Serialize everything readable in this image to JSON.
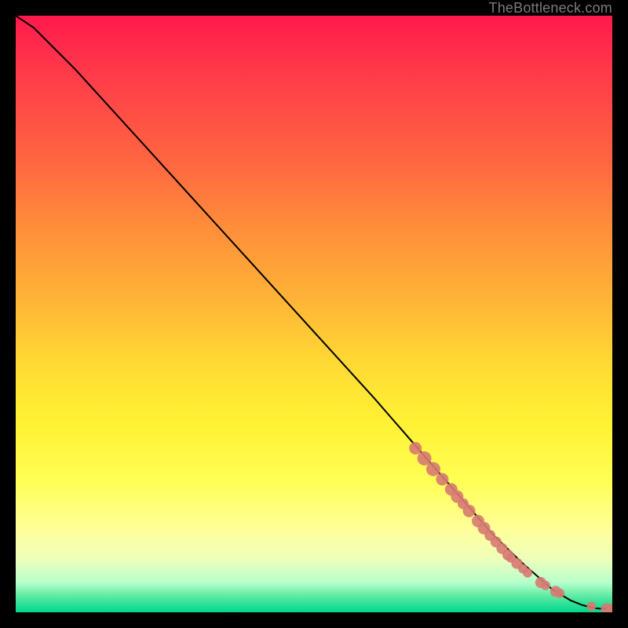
{
  "attribution": "TheBottleneck.com",
  "chart_data": {
    "type": "line",
    "title": "",
    "xlabel": "",
    "ylabel": "",
    "xlim": [
      0,
      100
    ],
    "ylim": [
      0,
      100
    ],
    "grid": false,
    "series": [
      {
        "name": "curve",
        "style": "line",
        "color": "#000000",
        "x": [
          0,
          3,
          6,
          10,
          20,
          30,
          40,
          50,
          60,
          70,
          80,
          85,
          90,
          93,
          95,
          97,
          98,
          100
        ],
        "y": [
          100,
          98,
          95,
          91,
          80,
          69,
          58,
          47,
          36,
          24.5,
          13,
          8.2,
          3.8,
          2.0,
          1.2,
          0.7,
          0.6,
          0.6
        ]
      },
      {
        "name": "points",
        "style": "scatter",
        "color": "#d77a72",
        "x": [
          67,
          68.5,
          70,
          71.5,
          73,
          74,
          75,
          76,
          77.5,
          78.5,
          79.5,
          80.5,
          81.5,
          82.5,
          83,
          84,
          85,
          85.8,
          88,
          88.8,
          90.5,
          91.2,
          96.5,
          99,
          100
        ],
        "y": [
          27.5,
          25.8,
          24.0,
          22.3,
          20.6,
          19.4,
          18.2,
          17.0,
          15.3,
          14.1,
          12.9,
          11.8,
          10.7,
          9.6,
          9.1,
          8.2,
          7.3,
          6.6,
          5.0,
          4.5,
          3.5,
          3.2,
          1.0,
          0.6,
          0.6
        ],
        "r": [
          8,
          9,
          9,
          8,
          8,
          8,
          7,
          8,
          8,
          8,
          7,
          7,
          7,
          7,
          6,
          7,
          6,
          6,
          7,
          6,
          7,
          6,
          6,
          7,
          7
        ]
      }
    ]
  }
}
